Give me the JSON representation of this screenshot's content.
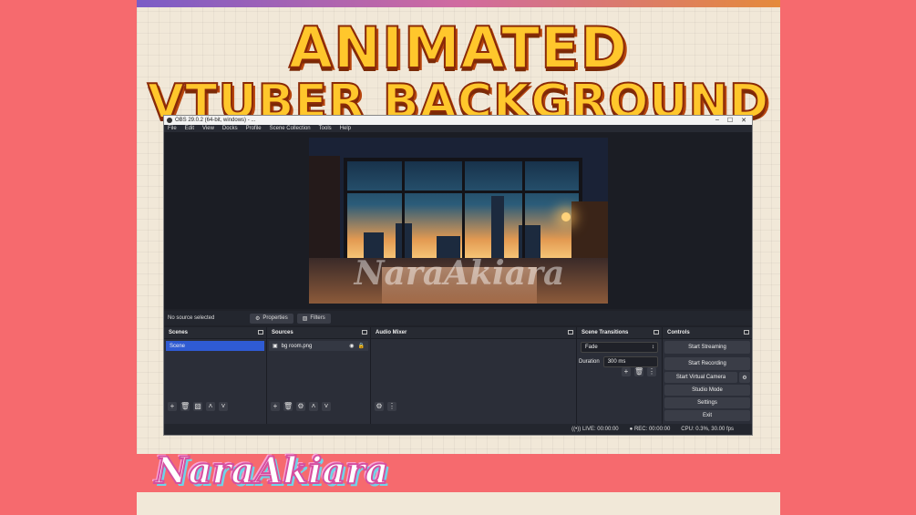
{
  "banner": {
    "line1": "ANIMATED",
    "line2": "VTUBER BACKGROUND"
  },
  "window": {
    "title": "OBS 29.0.2 (64-bit, windows) - ...",
    "controls": [
      "–",
      "☐",
      "✕"
    ]
  },
  "menu": [
    "File",
    "Edit",
    "View",
    "Docks",
    "Profile",
    "Scene Collection",
    "Tools",
    "Help"
  ],
  "preview": {
    "watermark": "NaraAkiara"
  },
  "status_row": {
    "no_source": "No source selected",
    "properties": "Properties",
    "filters": "Filters"
  },
  "docks": {
    "scenes": {
      "title": "Scenes",
      "items": [
        "Scene"
      ]
    },
    "sources": {
      "title": "Sources",
      "items": [
        "bg room.png"
      ]
    },
    "audio_mixer": {
      "title": "Audio Mixer"
    },
    "transitions": {
      "title": "Scene Transitions",
      "selected": "Fade",
      "duration_label": "Duration",
      "duration_value": "300 ms"
    },
    "controls": {
      "title": "Controls",
      "buttons": [
        "Start Streaming",
        "Start Recording",
        "Start Virtual Camera",
        "Studio Mode",
        "Settings",
        "Exit"
      ]
    }
  },
  "footer": {
    "live": "LIVE: 00:00:00",
    "rec": "REC: 00:00:00",
    "cpu": "CPU: 0.3%, 30.00 fps"
  },
  "brand_logo": "NaraAkiara",
  "colors": {
    "accent": "#2f5bd3",
    "background": "#f66a6e",
    "headline": "#ffc72c"
  }
}
